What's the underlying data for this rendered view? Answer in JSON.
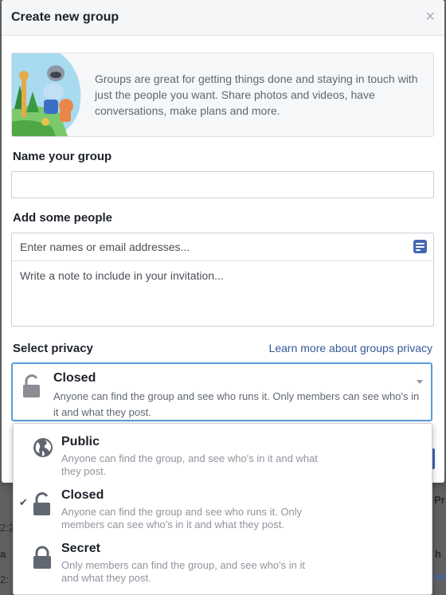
{
  "dialog": {
    "title": "Create new group",
    "close_glyph": "×"
  },
  "intro": {
    "text": "Groups are great for getting things done and staying in touch with just the people you want. Share photos and videos, have conversations, make plans and more.",
    "illustration_icon": "animals-illustration"
  },
  "name_section": {
    "label": "Name your group",
    "value": ""
  },
  "people_section": {
    "label": "Add some people",
    "people_placeholder": "Enter names or email addresses...",
    "note_placeholder": "Write a note to include in your invitation...",
    "note_icon": "note-icon"
  },
  "privacy_section": {
    "label": "Select privacy",
    "learn_more": "Learn more about groups privacy",
    "selected": {
      "title": "Closed",
      "description": "Anyone can find the group and see who runs it. Only members can see who's in it and what they post."
    },
    "options": [
      {
        "title": "Public",
        "description": "Anyone can find the group, and see who's in it and what they post.",
        "icon": "globe-icon",
        "checked": false
      },
      {
        "title": "Closed",
        "description": "Anyone can find the group and see who runs it. Only members can see who's in it and what they post.",
        "icon": "unlock-icon",
        "checked": true
      },
      {
        "title": "Secret",
        "description": "Only members can find the group, and see who's in it and what they post.",
        "icon": "lock-icon",
        "checked": false
      }
    ],
    "check_glyph": "✔"
  },
  "background": {
    "fragments": [
      "Pr",
      "2:2",
      "a",
      "2:",
      "h",
      "ne"
    ]
  },
  "colors": {
    "accent": "#4267b2",
    "link": "#365899",
    "focus": "#5b9dd9"
  }
}
